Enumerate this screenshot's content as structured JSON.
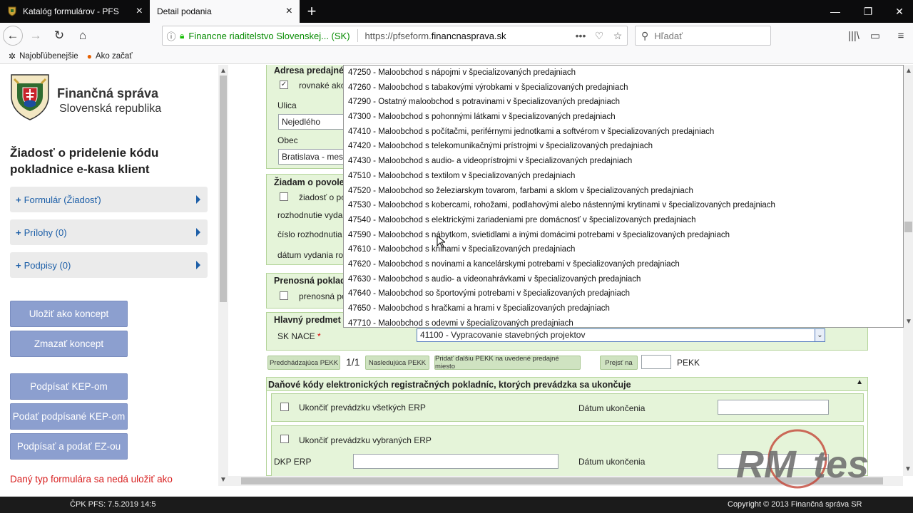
{
  "browser": {
    "tabs": [
      {
        "label": "Katalóg formulárov - PFS"
      },
      {
        "label": "Detail podania"
      }
    ],
    "url_identity": "Financne riaditelstvo Slovenskej... (SK)",
    "url_prefix": "https://pfseform.",
    "url_domain": "financnasprava.sk",
    "search_placeholder": "Hľadať",
    "bookmarks": [
      "Najobľúbenejšie",
      "Ako začať"
    ]
  },
  "sidebar": {
    "org_name": "Finančná správa",
    "org_sub": "Slovenská republika",
    "form_title": "Žiadosť o pridelenie kódu pokladnice e-kasa klient",
    "accordions": [
      {
        "label": "Formulár (Žiadosť)"
      },
      {
        "label": "Prílohy (0)"
      },
      {
        "label": "Podpisy (0)"
      }
    ],
    "buttons": {
      "save": "Uložiť ako koncept",
      "delete": "Zmazať koncept",
      "sign_kep": "Podpísať KEP-om",
      "submit_kep": "Podať podpísané KEP-om",
      "sign_submit_ez": "Podpísať a podať EZ-ou"
    },
    "warning": "Daný typ formulára sa nedá uložiť ako"
  },
  "form": {
    "address_head": "Adresa predajné",
    "same_address_label": "rovnaké ako",
    "street_label": "Ulica",
    "street_value": "Nejedlého",
    "city_label": "Obec",
    "city_value": "Bratislava - mest",
    "request_head": "Žiadam o povole",
    "request_label": "žiadosť o po",
    "decision_label": "rozhodnutie vydan",
    "decision_no_label": "číslo rozhodnutia",
    "decision_date_label": "dátum vydania roz",
    "portable_head": "Prenosná poklad",
    "portable_label": "prenosná po",
    "main_head": "Hlavný predmet",
    "sk_nace_label": "SK NACE",
    "sk_nace_required": "*",
    "sk_nace_value": "41100 - Vypracovanie stavebných projektov",
    "prev_btn": "Predchádzajúca PEKK",
    "page_indicator": "1/1",
    "next_btn": "Nasledujúca PEKK",
    "add_btn": "Pridať ďalšiu PEKK na uvedené predajné miesto",
    "goto_btn": "Prejsť na",
    "pekk_label": "PEKK",
    "erp_head": "Daňové kódy elektronických registračných pokladníc, ktorých prevádzka sa ukončuje",
    "end_all_label": "Ukončiť prevádzku všetkých ERP",
    "end_date_label": "Dátum ukončenia",
    "end_selected_label": "Ukončiť prevádzku vybraných ERP",
    "dkp_label": "DKP ERP",
    "end_date_label2": "Dátum ukončenia"
  },
  "dropdown_options": [
    "47250 - Maloobchod s nápojmi v špecializovaných predajniach",
    "47260 - Maloobchod s tabakovými výrobkami v špecializovaných predajniach",
    "47290 - Ostatný maloobchod s potravinami v špecializovaných predajniach",
    "47300 - Maloobchod s pohonnými látkami v špecializovaných predajniach",
    "47410 - Maloobchod s počítačmi, periférnymi jednotkami a softvérom v špecializovaných predajniach",
    "47420 - Maloobchod s telekomunikačnými prístrojmi v špecializovaných predajniach",
    "47430 - Maloobchod s audio- a videoprístrojmi v špecializovaných predajniach",
    "47510 - Maloobchod s textilom v špecializovaných predajniach",
    "47520 - Maloobchod so železiarskym tovarom, farbami a sklom v špecializovaných predajniach",
    "47530 - Maloobchod s kobercami, rohožami, podlahovými alebo nástennými krytinami v špecializovaných predajniach",
    "47540 - Maloobchod s elektrickými zariadeniami pre domácnosť v špecializovaných predajniach",
    "47590 - Maloobchod s nábytkom, svietidlami a inými domácimi potrebami v špecializovaných predajniach",
    "47610 - Maloobchod s knihami v špecializovaných predajniach",
    "47620 - Maloobchod s novinami a kancelárskymi potrebami v špecializovaných predajniach",
    "47630 - Maloobchod s audio- a videonahrávkami v špecializovaných predajniach",
    "47640 - Maloobchod so športovými potrebami v špecializovaných predajniach",
    "47650 - Maloobchod s hračkami a hrami v špecializovaných predajniach",
    "47710 - Maloobchod s odevmi v špecializovaných predajniach"
  ],
  "footer": {
    "left": "ČPK PFS: 7.5.2019 14:5",
    "right": "Copyright © 2013 Finančná správa SR"
  },
  "watermark": {
    "text_left": "RM",
    "text_right": "tes"
  },
  "colors": {
    "panel_bg": "#e5f4d9",
    "button_bg": "#8c9fcf",
    "link_blue": "#1d5fa8",
    "warning_red": "#d82020"
  }
}
